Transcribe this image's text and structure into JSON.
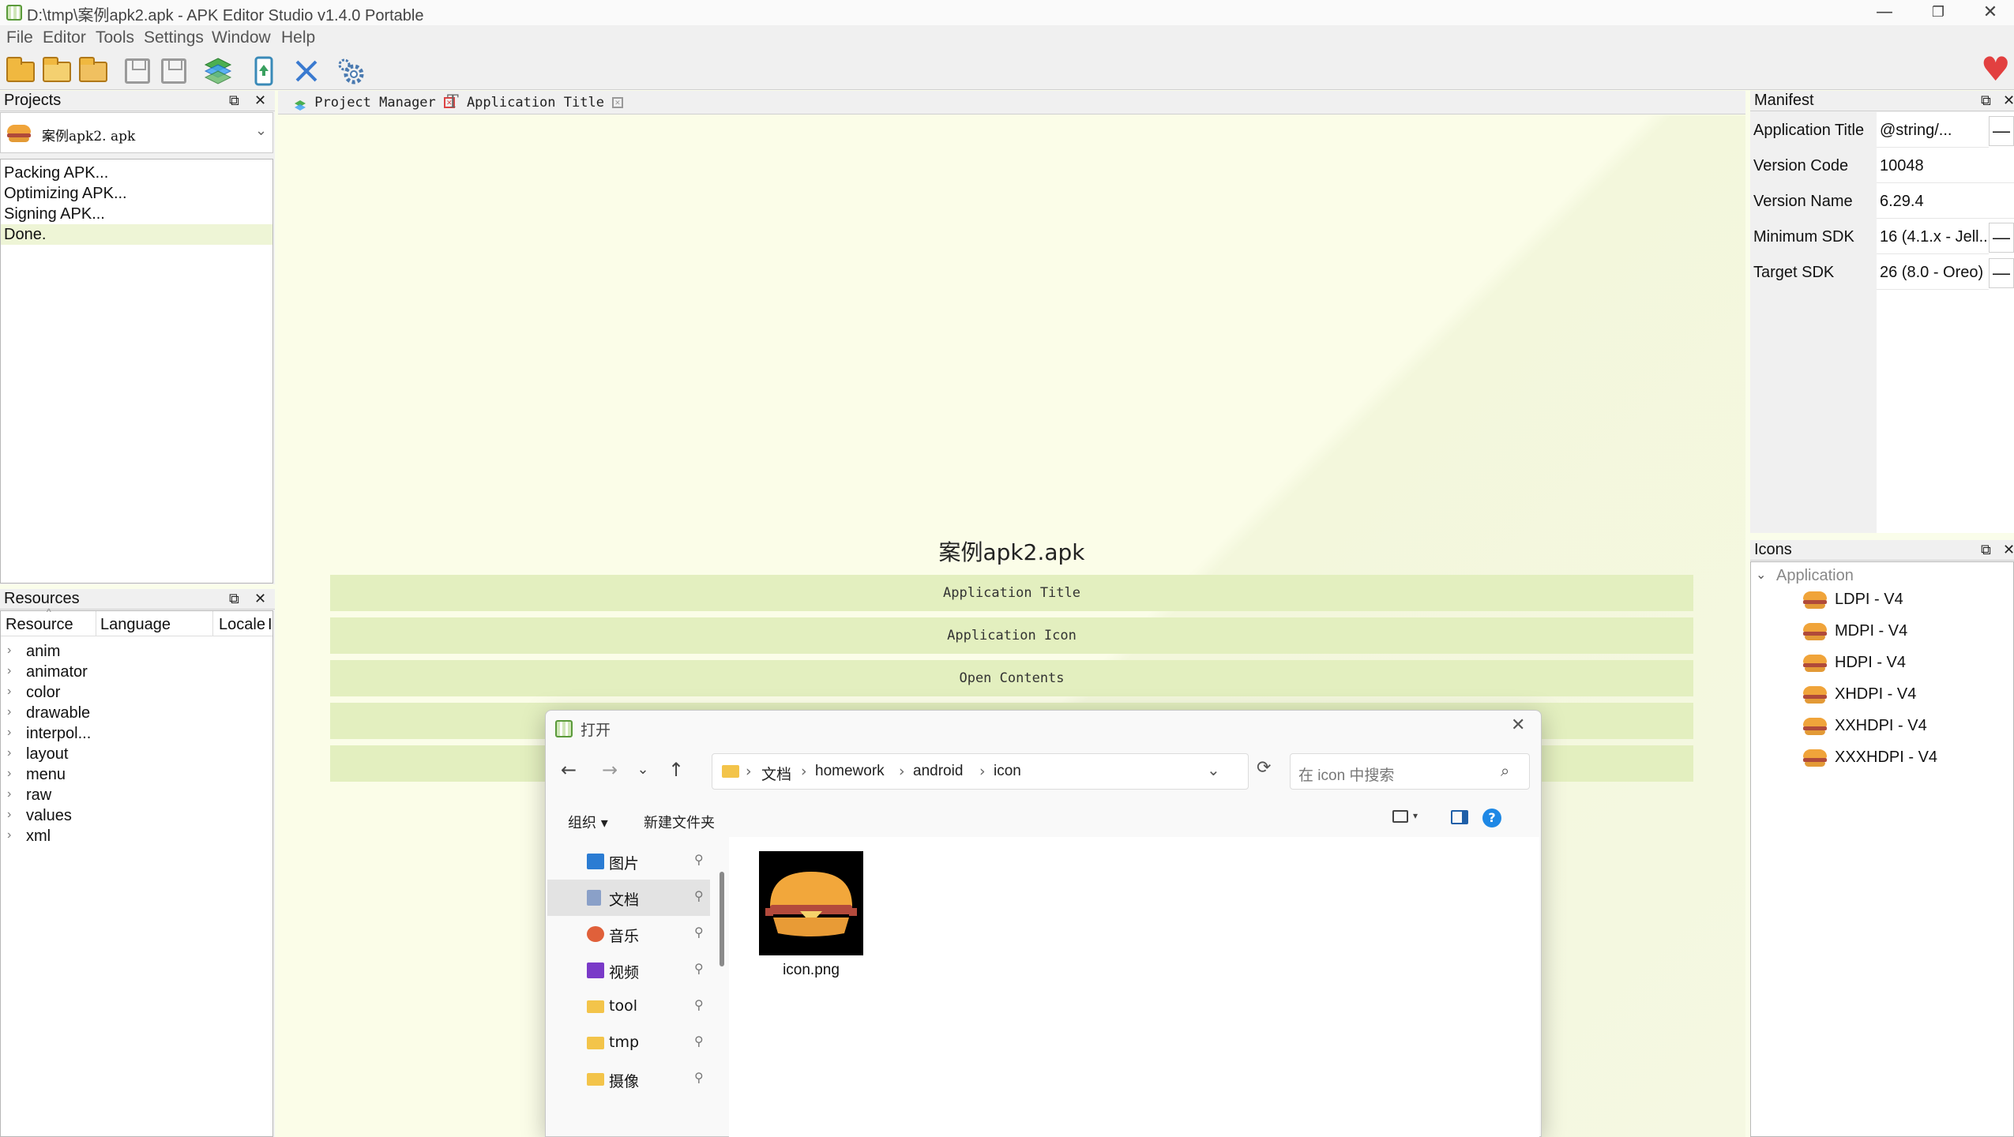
{
  "window": {
    "title": "D:\\tmp\\案例apk2.apk  - APK Editor Studio v1.4.0 Portable"
  },
  "menu": [
    "File",
    "Editor",
    "Tools",
    "Settings",
    "Window",
    "Help"
  ],
  "projects": {
    "title": "Projects",
    "selected_project": "案例apk2. apk",
    "log": [
      "Packing APK...",
      "Optimizing APK...",
      "Signing APK...",
      "Done."
    ]
  },
  "resources": {
    "title": "Resources",
    "columns": [
      "Resource",
      "Language",
      "Locale",
      "I"
    ],
    "items": [
      "anim",
      "animator",
      "color",
      "drawable",
      "interpol...",
      "layout",
      "menu",
      "raw",
      "values",
      "xml"
    ]
  },
  "tabs": [
    {
      "label": "Project Manager",
      "icon": "layers-icon"
    },
    {
      "label": "Application Title",
      "icon": "text-t-icon"
    }
  ],
  "project_manager": {
    "apk_name": "案例apk2.apk",
    "buttons": [
      "Application Title",
      "Application Icon",
      "Open Contents",
      "",
      ""
    ]
  },
  "manifest": {
    "title": "Manifest",
    "rows": [
      {
        "key": "Application Title",
        "value": "@string/...",
        "has_button": true
      },
      {
        "key": "Version Code",
        "value": "10048",
        "has_button": false
      },
      {
        "key": "Version Name",
        "value": "6.29.4",
        "has_button": false
      },
      {
        "key": "Minimum SDK",
        "value": "16 (4.1.x - Jell...",
        "has_button": true
      },
      {
        "key": "Target SDK",
        "value": "26 (8.0 - Oreo)",
        "has_button": true
      }
    ],
    "button_glyph": "—"
  },
  "icons": {
    "title": "Icons",
    "group": "Application",
    "items": [
      "LDPI - V4",
      "MDPI - V4",
      "HDPI - V4",
      "XHDPI - V4",
      "XXHDPI - V4",
      "XXXHDPI - V4"
    ]
  },
  "dialog": {
    "title": "打开",
    "path": [
      "文档",
      "homework",
      "android",
      "icon"
    ],
    "search_placeholder": "在 icon 中搜索",
    "organize": "组织 ▾",
    "new_folder": "新建文件夹",
    "nav_items": [
      {
        "label": "图片",
        "icon": "pictures-icon"
      },
      {
        "label": "文档",
        "icon": "documents-icon"
      },
      {
        "label": "音乐",
        "icon": "music-icon"
      },
      {
        "label": "视频",
        "icon": "videos-icon"
      },
      {
        "label": "tool",
        "icon": "folder-icon"
      },
      {
        "label": "tmp",
        "icon": "folder-icon"
      },
      {
        "label": "摄像",
        "icon": "folder-icon"
      }
    ],
    "file": "icon.png"
  },
  "colors": {
    "accent_green": "#e3efbf",
    "workspace_bg": "#fbfde8",
    "heart": "#e24040",
    "help_blue": "#1e88e5"
  }
}
